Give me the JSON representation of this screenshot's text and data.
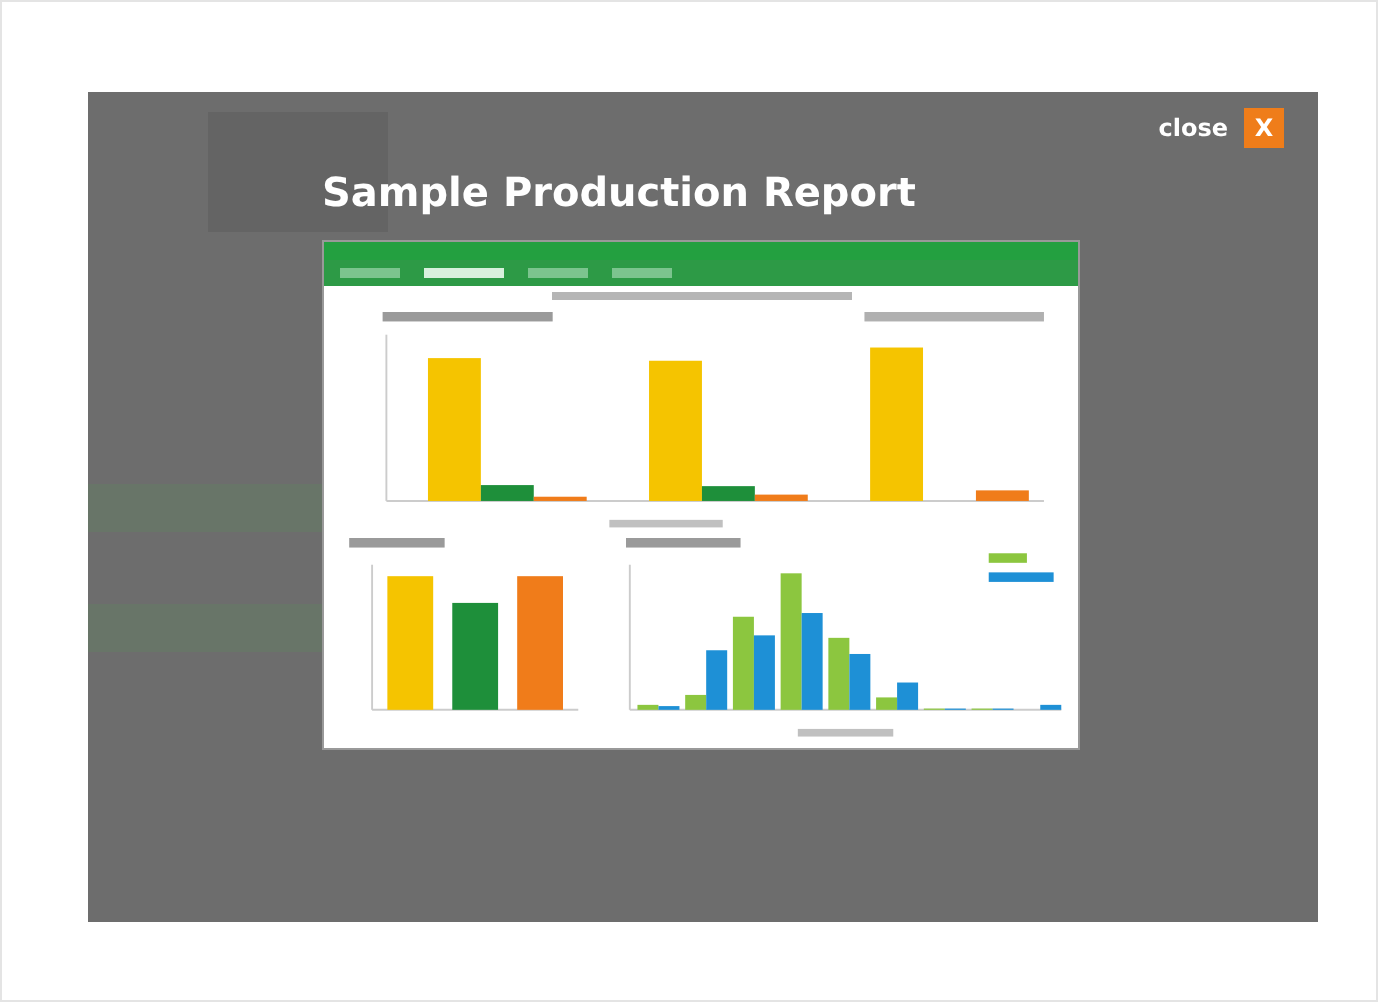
{
  "lightbox": {
    "close_label": "close",
    "close_button": "X",
    "title": "Sample Production Report"
  }
}
